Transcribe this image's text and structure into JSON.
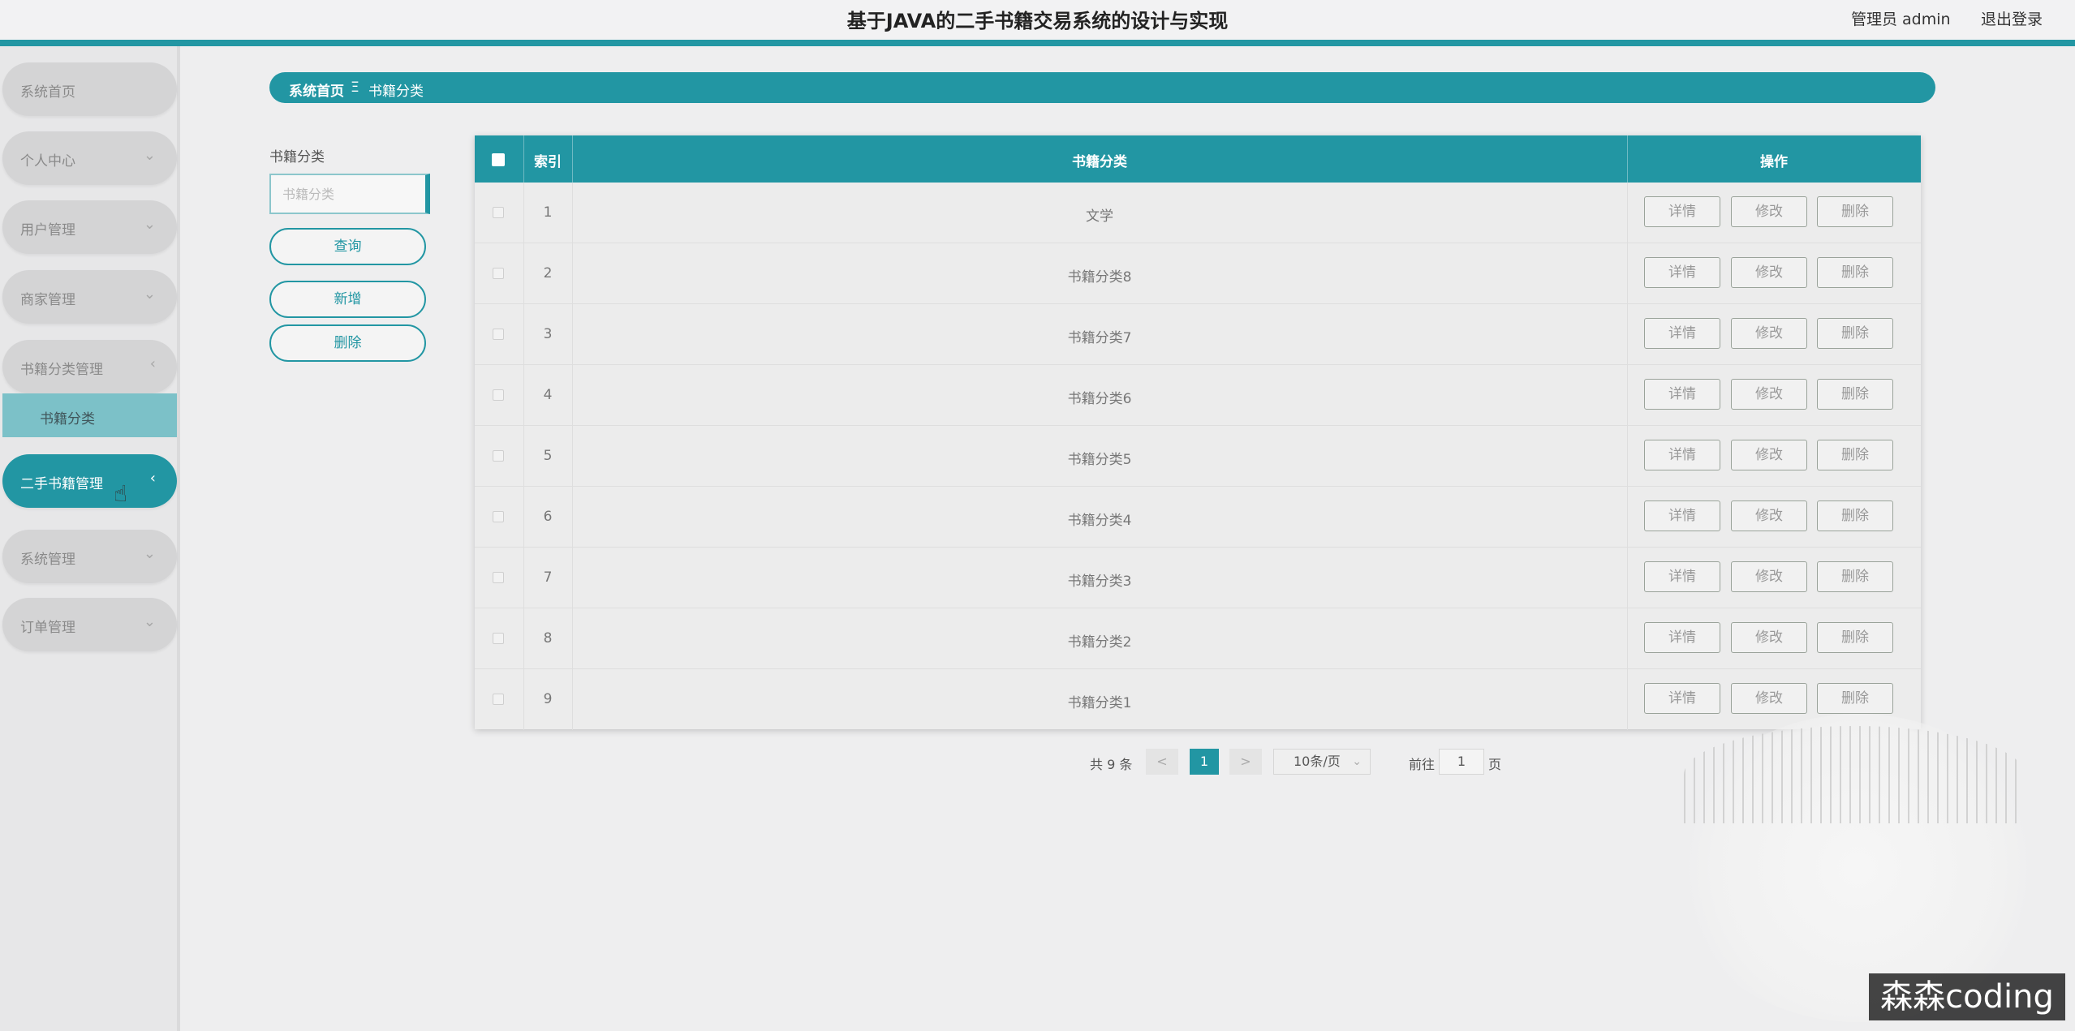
{
  "header": {
    "title": "基于JAVA的二手书籍交易系统的设计与实现",
    "user": "管理员 admin",
    "logout": "退出登录"
  },
  "sidebar": {
    "items": [
      {
        "label": "系统首页"
      },
      {
        "label": "个人中心"
      },
      {
        "label": "用户管理"
      },
      {
        "label": "商家管理"
      },
      {
        "label": "书籍分类管理"
      },
      {
        "label": "二手书籍管理"
      },
      {
        "label": "系统管理"
      },
      {
        "label": "订单管理"
      }
    ],
    "sub_item": "书籍分类"
  },
  "breadcrumb": {
    "home": "系统首页",
    "separator": "Ξ",
    "current": "书籍分类"
  },
  "search": {
    "label": "书籍分类",
    "placeholder": "书籍分类",
    "query_btn": "查询",
    "add_btn": "新增",
    "delete_btn": "删除"
  },
  "table": {
    "headers": {
      "index": "索引",
      "category": "书籍分类",
      "actions": "操作"
    },
    "rows": [
      {
        "index": "1",
        "category": "文学"
      },
      {
        "index": "2",
        "category": "书籍分类8"
      },
      {
        "index": "3",
        "category": "书籍分类7"
      },
      {
        "index": "4",
        "category": "书籍分类6"
      },
      {
        "index": "5",
        "category": "书籍分类5"
      },
      {
        "index": "6",
        "category": "书籍分类4"
      },
      {
        "index": "7",
        "category": "书籍分类3"
      },
      {
        "index": "8",
        "category": "书籍分类2"
      },
      {
        "index": "9",
        "category": "书籍分类1"
      }
    ],
    "row_actions": {
      "detail": "详情",
      "edit": "修改",
      "delete": "删除"
    }
  },
  "pagination": {
    "total": "共 9 条",
    "prev": "<",
    "current": "1",
    "next": ">",
    "page_size": "10条/页",
    "goto_label": "前往",
    "goto_value": "1",
    "page_suffix": "页"
  },
  "watermark": "森森coding",
  "colors": {
    "accent": "#2296a3",
    "sub_active": "#7cc1c8"
  }
}
